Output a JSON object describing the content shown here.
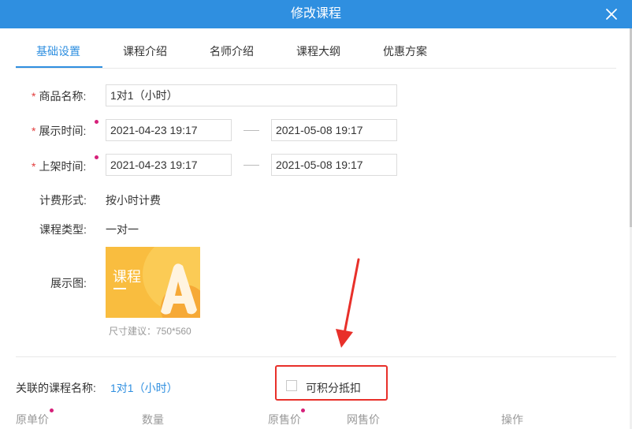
{
  "dialog": {
    "title": "修改课程",
    "close_icon": "close-icon",
    "accent_color": "#2f8fe0"
  },
  "tabs": [
    {
      "label": "基础设置",
      "active": true
    },
    {
      "label": "课程介绍",
      "active": false
    },
    {
      "label": "名师介绍",
      "active": false
    },
    {
      "label": "课程大纲",
      "active": false
    },
    {
      "label": "优惠方案",
      "active": false
    }
  ],
  "form": {
    "required_mark": "*",
    "product_name": {
      "label": "商品名称:",
      "value": "1对1（小时）"
    },
    "display_time": {
      "label": "展示时间:",
      "start": "2021-04-23 19:17",
      "end": "2021-05-08 19:17"
    },
    "shelf_time": {
      "label": "上架时间:",
      "start": "2021-04-23 19:17",
      "end": "2021-05-08 19:17"
    },
    "billing": {
      "label": "计费形式:",
      "value": "按小时计费"
    },
    "course_type": {
      "label": "课程类型:",
      "value": "一对一"
    },
    "display_image": {
      "label": "展示图:",
      "image_text": "课程",
      "image_letter": "A",
      "size_hint": "尺寸建议：750*560"
    }
  },
  "linked": {
    "label": "关联的课程名称:",
    "value": "1对1（小时）",
    "points_checkbox_label": "可积分抵扣",
    "points_checked": false
  },
  "table": {
    "columns": [
      "原单价",
      "数量",
      "原售价",
      "网售价",
      "操作"
    ]
  }
}
